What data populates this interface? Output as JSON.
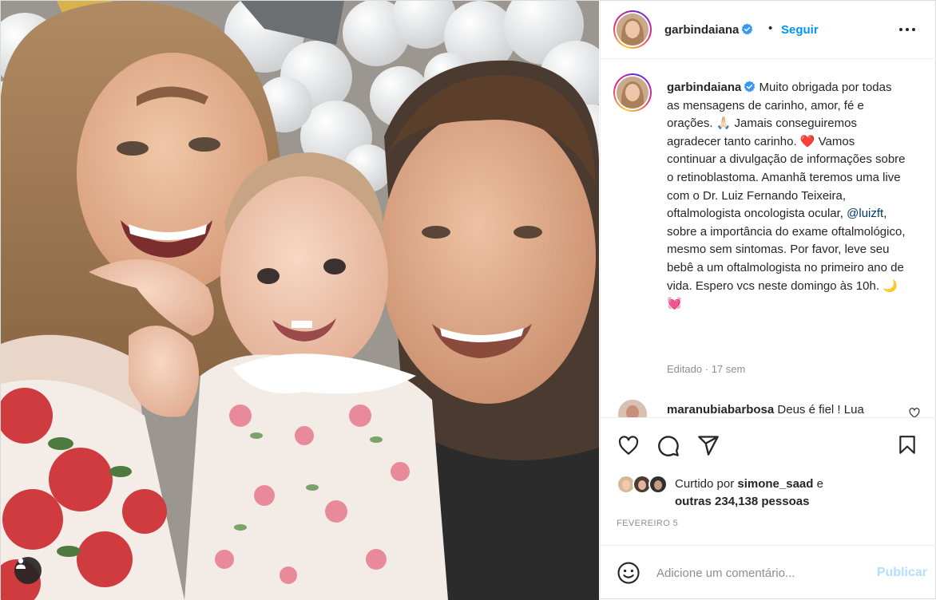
{
  "colors": {
    "link": "#0095f6",
    "text": "#262626",
    "muted": "#8e8e8e",
    "post_disabled": "#b2dffc",
    "mention": "#00376b"
  },
  "photo": {
    "alt_icon": "user-tag-icon"
  },
  "header": {
    "username": "garbindaiana",
    "separator": "•",
    "follow_label": "Seguir",
    "more_icon": "more-options-icon"
  },
  "caption": {
    "username": "garbindaiana",
    "text_1": "Muito obrigada por todas as mensagens de carinho, amor, fé e orações. 🙏🏻 Jamais conseguiremos agradecer tanto carinho. ❤️ Vamos continuar a divulgação de informações sobre o retinoblastoma. Amanhã teremos uma live com o Dr. Luiz Fernando Teixeira, oftalmologista oncologista ocular,",
    "mention": "@luizft",
    "text_2": ", sobre a importância do exame oftalmológico, mesmo sem sintomas. Por favor, leve seu bebê a um oftalmologista no primeiro ano de vida. Espero vcs neste domingo às 10h. 🌙 💓",
    "edited_label": "Editado",
    "meta_separator": "·",
    "time_ago": "17 sem"
  },
  "comment": {
    "username": "maranubiabarbosa",
    "text": "Deus é fiel ! Lua"
  },
  "actions": {
    "like_icon": "heart-icon",
    "comment_icon": "comment-bubble-icon",
    "share_icon": "paper-plane-icon",
    "save_icon": "bookmark-icon"
  },
  "likes": {
    "prefix": "Curtido por",
    "first_user": "simone_saad",
    "connector": "e",
    "others": "outras 234,138 pessoas"
  },
  "date": "FEVEREIRO 5",
  "add_comment": {
    "emoji_icon": "emoji-smile-icon",
    "placeholder": "Adicione um comentário...",
    "post_label": "Publicar"
  }
}
